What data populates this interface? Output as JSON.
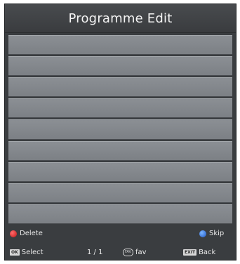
{
  "header": {
    "title": "Programme Edit"
  },
  "list": {
    "row_count": 9
  },
  "footer": {
    "delete_label": "Delete",
    "skip_label": "Skip",
    "select_key": "OK",
    "select_label": "Select",
    "page_indicator": "1 / 1",
    "fav_key": "FAV",
    "fav_label": "fav",
    "back_key": "EXIT",
    "back_label": "Back"
  },
  "colors": {
    "delete_button": "#d21f1f",
    "skip_button": "#2a63d6"
  }
}
